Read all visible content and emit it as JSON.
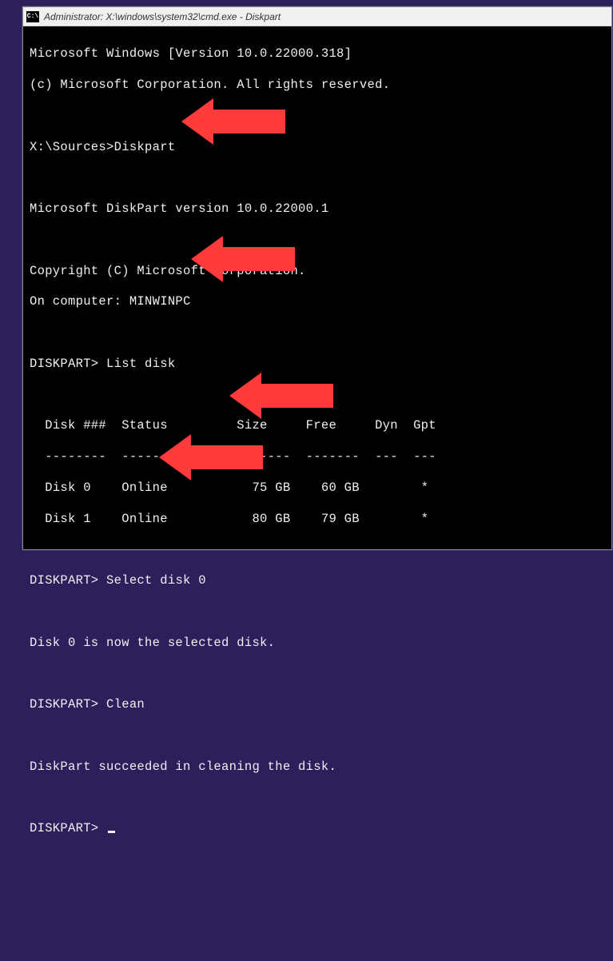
{
  "window": {
    "title": "Administrator: X:\\windows\\system32\\cmd.exe - Diskpart",
    "icon_label": "C:\\"
  },
  "terminal": {
    "header1": "Microsoft Windows [Version 10.0.22000.318]",
    "header2": "(c) Microsoft Corporation. All rights reserved.",
    "prompt1": "X:\\Sources>",
    "cmd1": "Diskpart",
    "diskpart_version": "Microsoft DiskPart version 10.0.22000.1",
    "copyright": "Copyright (C) Microsoft Corporation.",
    "computer": "On computer: MINWINPC",
    "prompt2": "DISKPART>",
    "cmd2": "List disk",
    "table_header": "  Disk ###  Status         Size     Free     Dyn  Gpt",
    "table_divider": "  --------  -------------  -------  -------  ---  ---",
    "row0": "  Disk 0    Online           75 GB    60 GB        *",
    "row1": "  Disk 1    Online           80 GB    79 GB        *",
    "cmd3": "Select disk 0",
    "result3": "Disk 0 is now the selected disk.",
    "cmd4": "Clean",
    "result4": "DiskPart succeeded in cleaning the disk.",
    "arrow_color": "#ff3b3b"
  }
}
